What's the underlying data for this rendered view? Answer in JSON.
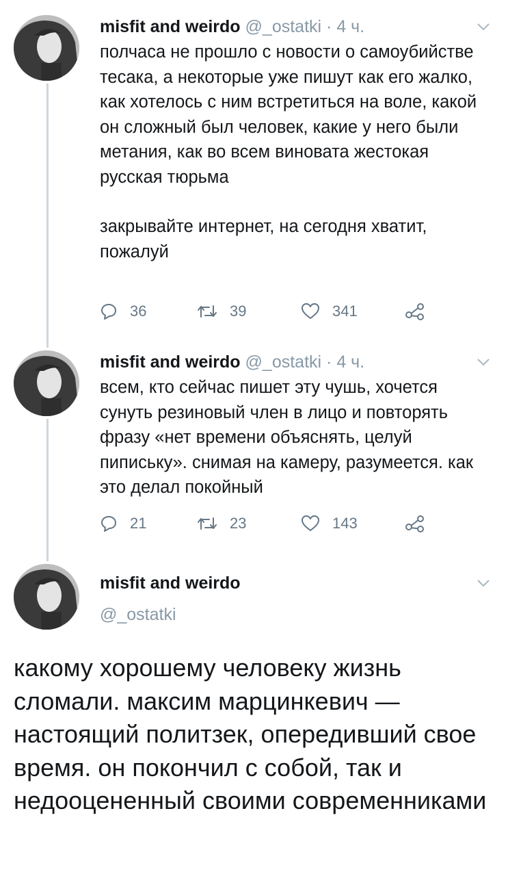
{
  "tweets": [
    {
      "name": "misfit and weirdo",
      "handle": "@_ostatki",
      "dot": "·",
      "time": "4 ч.",
      "text_p1": "полчаса не прошло с новости о самоубийстве тесака, а некоторые уже пишут как его жалко, как хотелось с ним встретиться на воле, какой он сложный был человек, какие у него были метания, как во всем виновата жестокая русская тюрьма",
      "text_p2": "закрывайте интернет, на сегодня хватит, пожалуй",
      "replies": "36",
      "retweets": "39",
      "likes": "341"
    },
    {
      "name": "misfit and weirdo",
      "handle": "@_ostatki",
      "dot": "·",
      "time": "4 ч.",
      "text_p1": "всем, кто сейчас пишет эту чушь, хочется сунуть резиновый член в лицо и повторять фразу «нет времени объяснять, целуй пипиську». снимая на камеру, разумеется. как это делал покойный",
      "replies": "21",
      "retweets": "23",
      "likes": "143"
    }
  ],
  "main_tweet": {
    "name": "misfit and weirdo",
    "handle": "@_ostatki",
    "text": "какому хорошему человеку жизнь сломали. максим марцинкевич — настоящий политзек, опередивший свое время. он покончил с собой, так и недооцененный своими современниками"
  },
  "icons": {
    "reply": "reply-icon",
    "retweet": "retweet-icon",
    "like": "heart-icon",
    "share": "share-icon",
    "menu": "chevron-down-icon",
    "avatar": "avatar-photo"
  },
  "colors": {
    "text": "#14171a",
    "secondary": "#8899a6",
    "action": "#657786",
    "thread_line": "#ccd6dd"
  }
}
